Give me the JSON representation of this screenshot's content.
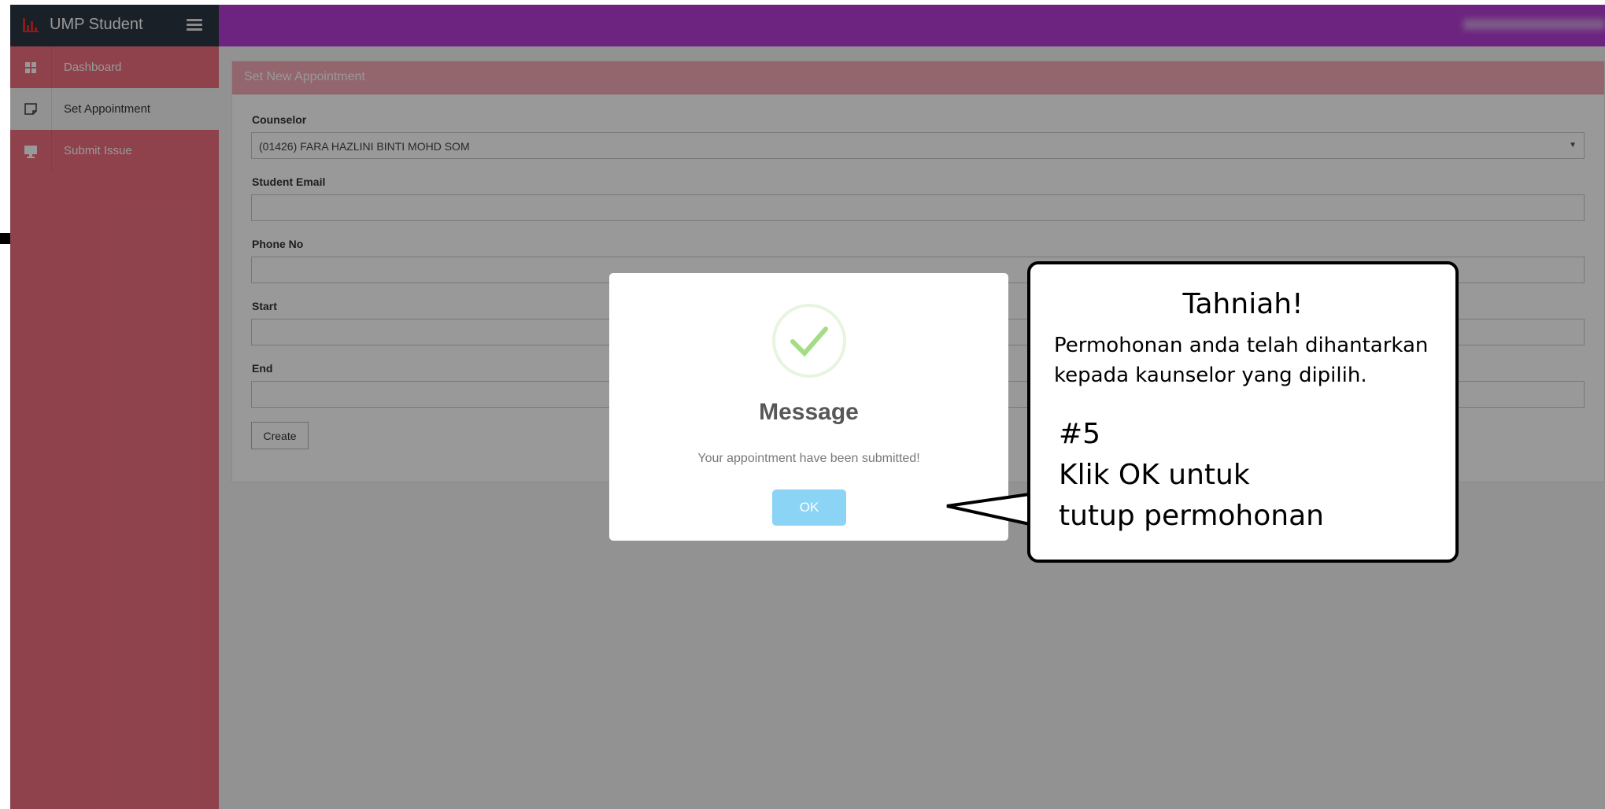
{
  "app": {
    "title": "UMP Student",
    "logo_icon": "bar-chart-icon",
    "menu_icon": "hamburger-icon"
  },
  "colors": {
    "topbar": "#b63cd5",
    "sidebar": "#ee6f7e",
    "brand_bg": "#2b3643",
    "panel_header": "#f3aab4",
    "ok_button": "#8cd4f5"
  },
  "sidebar": {
    "items": [
      {
        "label": "Dashboard",
        "icon": "grid-icon",
        "active": false
      },
      {
        "label": "Set Appointment",
        "icon": "note-icon",
        "active": true
      },
      {
        "label": "Submit Issue",
        "icon": "monitor-icon",
        "active": false
      }
    ]
  },
  "form": {
    "panel_title": "Set New Appointment",
    "counselor_label": "Counselor",
    "counselor_value": "(01426) FARA HAZLINI BINTI MOHD SOM",
    "email_label": "Student Email",
    "phone_label": "Phone No",
    "start_label": "Start",
    "end_label": "End",
    "create_label": "Create"
  },
  "modal": {
    "icon": "check-icon",
    "title": "Message",
    "text": "Your appointment have been submitted!",
    "ok_label": "OK"
  },
  "callout": {
    "title": "Tahniah!",
    "message": "Permohonan anda telah dihantarkan kepada kaunselor yang dipilih.",
    "step": "#5",
    "instruction_line1": "Klik OK untuk",
    "instruction_line2": "tutup permohonan"
  }
}
